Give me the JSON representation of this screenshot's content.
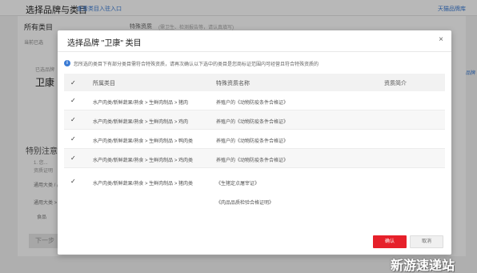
{
  "background": {
    "page_title": "选择品牌与类目",
    "header_link": "查看类目入驻入口",
    "right_link": "天猫品牌库",
    "category_label": "所有类目",
    "special_label": "特殊资质",
    "special_text": "(需卫生、检测报告等，请认真填写)",
    "info_row": "当前已选",
    "brand_small_label": "已选品牌",
    "brand_name": "卫康",
    "notice_title": "特别注意",
    "notice_line1": "1. 您...",
    "notice_line2": "资质证明",
    "tag_row1": "通用大类 / 品牌",
    "tag_row2": "通用大类 > 品牌",
    "tag_row3": "食品",
    "next_button": "下一步",
    "right_edge": "品牌"
  },
  "modal": {
    "title": "选择品牌 \"卫康\" 类目",
    "close_label": "×",
    "notice": "您所选的类目下有部分类目需符合特殊资质，请再次确认以下选中的类目是您商标证范围内可经营且符合特殊资质的",
    "columns": {
      "check": "✓",
      "category": "所属类目",
      "qualification": "特殊资质名称",
      "intro": "资质简介"
    },
    "rows": [
      {
        "check": "✓",
        "category": "水产肉类/新鲜蔬果/熟食 > 生鲜肉制品 > 猪肉",
        "qualifications": [
          "养殖户的《动物防疫条件合格证》"
        ]
      },
      {
        "check": "✓",
        "category": "水产肉类/新鲜蔬果/熟食 > 生鲜肉制品 > 鸡肉",
        "qualifications": [
          "养殖户的《动物防疫条件合格证》"
        ]
      },
      {
        "check": "✓",
        "category": "水产肉类/新鲜蔬果/熟食 > 生鲜肉制品 > 鸭肉类",
        "qualifications": [
          "养殖户的《动物防疫条件合格证》"
        ]
      },
      {
        "check": "✓",
        "category": "水产肉类/新鲜蔬果/熟食 > 生鲜肉制品 > 鸡肉类",
        "qualifications": [
          "养殖户的《动物防疫条件合格证》"
        ]
      },
      {
        "check": "✓",
        "category": "水产肉类/新鲜蔬果/熟食 > 生鲜肉制品 > 猪肉类",
        "qualifications": [
          "《生猪定点屠宰证》",
          "《肉品品质检验合格证明》"
        ]
      }
    ],
    "confirm_label": "确认",
    "cancel_label": "取消"
  },
  "watermark": "新游速递站",
  "colors": {
    "accent": "#e6202a",
    "link": "#3a7bd5"
  }
}
